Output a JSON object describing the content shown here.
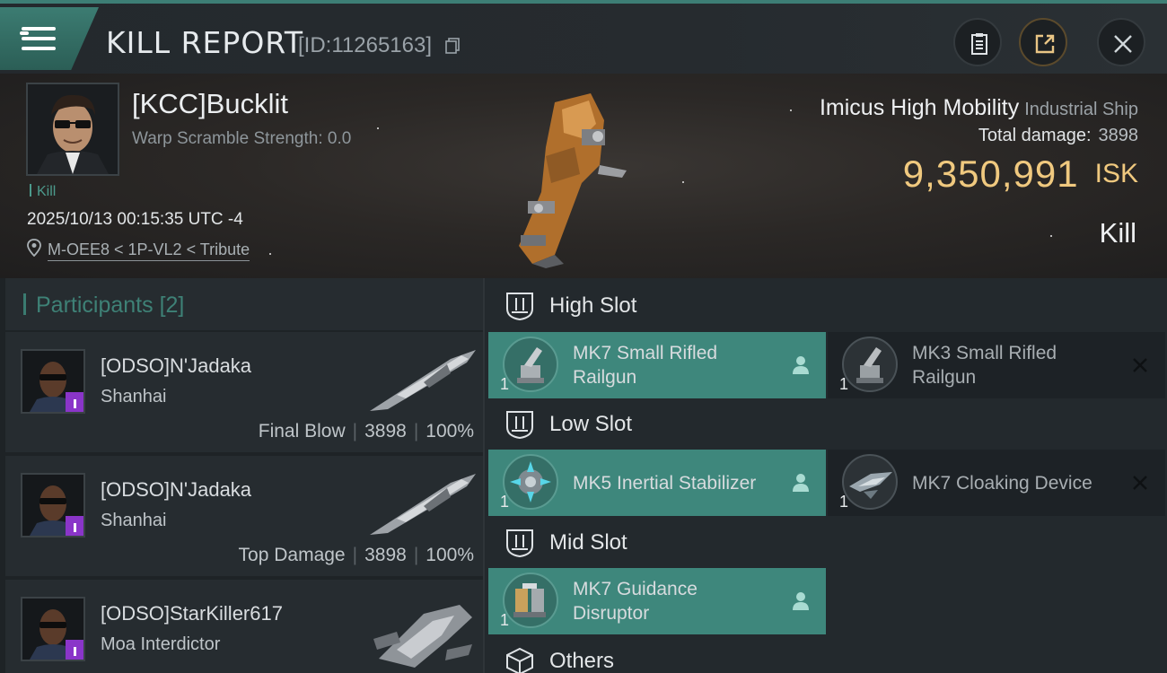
{
  "header": {
    "title": "KILL REPORT",
    "report_id": "[ID:11265163]",
    "menu_icon": "hamburger-menu-icon",
    "actions": [
      {
        "icon": "clipboard-icon"
      },
      {
        "icon": "share-icon"
      },
      {
        "icon": "close-icon"
      }
    ]
  },
  "victim": {
    "name": "[KCC]Bucklit",
    "warp_scramble": "Warp Scramble Strength: 0.0",
    "tag": "Kill",
    "datetime": "2025/10/13 00:15:35 UTC -4",
    "location": "M-OEE8 < 1P-VL2 < Tribute"
  },
  "ship": {
    "name": "Imicus High Mobility",
    "class": "Industrial Ship",
    "total_damage_label": "Total damage:",
    "total_damage": "3898",
    "isk_value": "9,350,991",
    "isk_unit": "ISK",
    "result": "Kill"
  },
  "participants": {
    "label": "Participants",
    "count": "[2]",
    "items": [
      {
        "name": "[ODSO]N'Jadaka",
        "ship": "Shanhai",
        "role": "Final Blow",
        "damage": "3898",
        "percent": "100%"
      },
      {
        "name": "[ODSO]N'Jadaka",
        "ship": "Shanhai",
        "role": "Top Damage",
        "damage": "3898",
        "percent": "100%"
      },
      {
        "name": "[ODSO]StarKiller617",
        "ship": "Moa Interdictor"
      }
    ]
  },
  "slots": {
    "high": {
      "label": "High Slot",
      "modules": [
        {
          "qty": "1",
          "name_line1": "MK7 Small Rifled",
          "name_line2": "Railgun",
          "state": "dropped"
        },
        {
          "qty": "1",
          "name_line1": "MK3 Small Rifled",
          "name_line2": "Railgun",
          "state": "destroyed"
        }
      ]
    },
    "low": {
      "label": "Low Slot",
      "modules": [
        {
          "qty": "1",
          "name_line1": "MK5 Inertial Stabilizer",
          "state": "dropped"
        },
        {
          "qty": "1",
          "name_line1": "MK7 Cloaking Device",
          "state": "destroyed"
        }
      ]
    },
    "mid": {
      "label": "Mid Slot",
      "modules": [
        {
          "qty": "1",
          "name_line1": "MK7 Guidance",
          "name_line2": "Disruptor",
          "state": "dropped"
        }
      ]
    },
    "others": {
      "label": "Others"
    }
  },
  "colors": {
    "accent": "#3e877c",
    "isk": "#f0c97f",
    "text": "#e3e6e8"
  }
}
